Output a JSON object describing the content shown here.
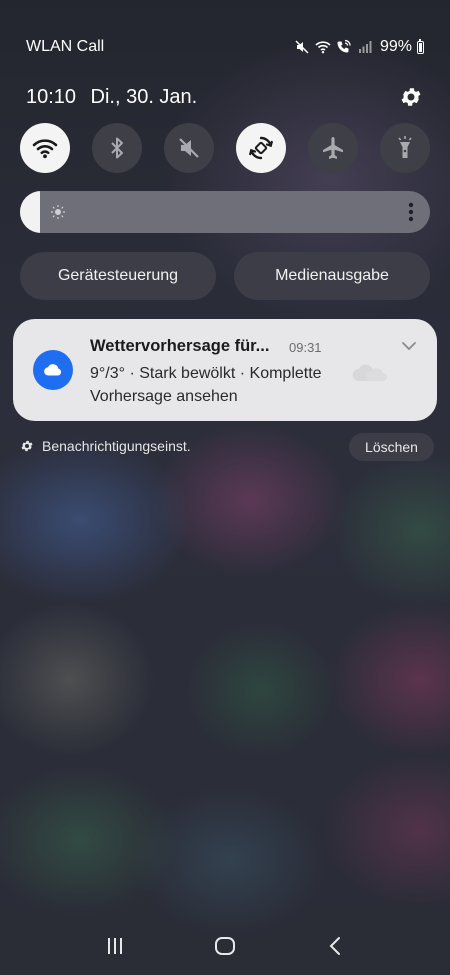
{
  "status_bar": {
    "carrier": "WLAN Call",
    "battery_percent": "99%",
    "icons": [
      "mute-icon",
      "wifi-icon",
      "wifi-calling-icon",
      "signal-icon",
      "battery-icon"
    ]
  },
  "header": {
    "time": "10:10",
    "date": "Di., 30. Jan."
  },
  "quick_settings": [
    {
      "name": "wifi",
      "icon": "wifi-icon",
      "active": true
    },
    {
      "name": "bluetooth",
      "icon": "bluetooth-icon",
      "active": false
    },
    {
      "name": "sound",
      "icon": "mute-icon",
      "active": false
    },
    {
      "name": "auto-rotate",
      "icon": "auto-rotate-icon",
      "active": true
    },
    {
      "name": "airplane-mode",
      "icon": "airplane-icon",
      "active": false
    },
    {
      "name": "flashlight",
      "icon": "flashlight-icon",
      "active": false
    }
  ],
  "brightness": {
    "level": 0.05
  },
  "buttons": {
    "device_control": "Gerätesteuerung",
    "media_output": "Medienausgabe"
  },
  "notification": {
    "title": "Wettervorhersage für...",
    "time": "09:31",
    "body": "9°/3° · Stark bewölkt · Komplette Vorhersage ansehen",
    "icon": "cloud-icon"
  },
  "footer": {
    "notification_settings": "Benachrichtigungseinst.",
    "clear": "Löschen"
  },
  "colors": {
    "accent_blue": "#1f6df1",
    "tile_active": "#f4f4f4",
    "tile_inactive": "#3e3f47"
  }
}
